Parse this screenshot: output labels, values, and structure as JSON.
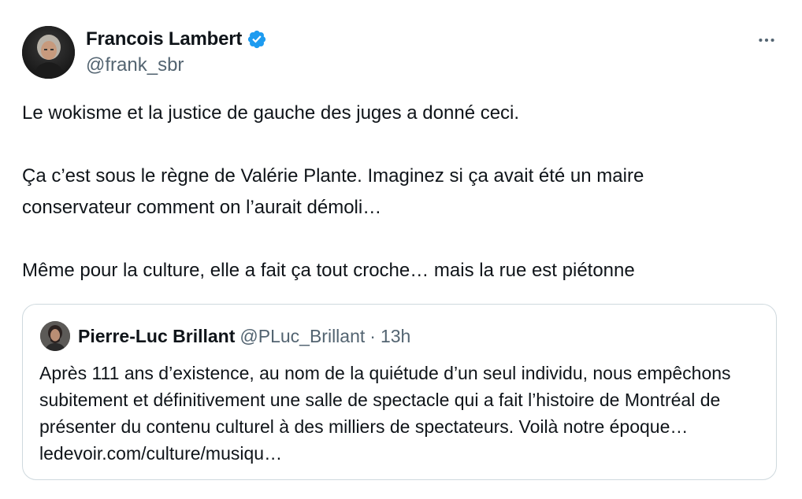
{
  "tweet": {
    "author": {
      "display_name": "Francois Lambert",
      "handle": "@frank_sbr",
      "verified": true,
      "verified_color": "#1d9bf0"
    },
    "more_icon": "more-horizontal-icon",
    "paragraphs": [
      "Le wokisme et la justice de gauche des juges a donné ceci.",
      "Ça c’est sous le règne de Valérie Plante. Imaginez si ça avait été un maire\nconservateur comment on l’aurait démoli…",
      "Même pour la culture, elle a fait ça tout croche… mais la rue est piétonne"
    ],
    "quoted": {
      "display_name": "Pierre-Luc Brillant",
      "handle": "@PLuc_Brillant",
      "separator": "·",
      "time": "13h",
      "text": "Après 111 ans d’existence, au nom de la quiétude d’un seul individu, nous empêchons subitement et définitivement une salle de spectacle qui a fait l’histoire de Montréal de présenter du contenu culturel à des milliers de spectateurs. Voilà notre époque… ledevoir.com/culture/musiqu…"
    }
  },
  "colors": {
    "text_primary": "#0f1419",
    "text_secondary": "#536471",
    "border": "#cfd9de",
    "accent": "#1d9bf0"
  }
}
